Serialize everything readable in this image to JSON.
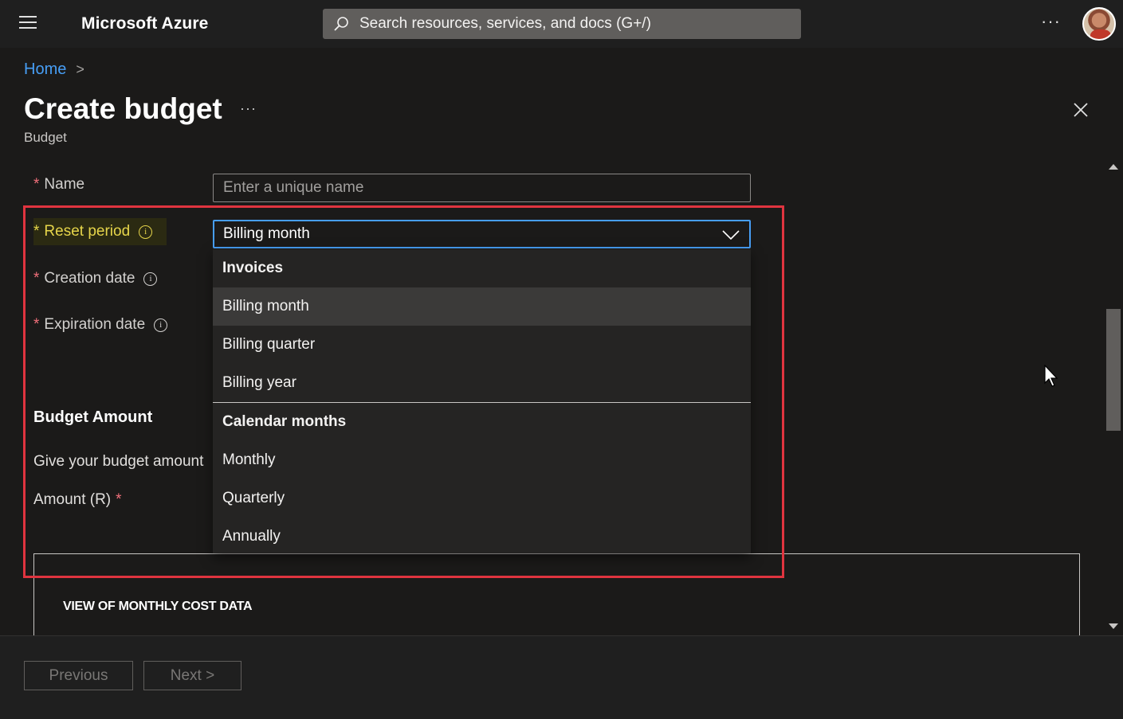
{
  "topbar": {
    "brand": "Microsoft Azure",
    "search_placeholder": "Search resources, services, and docs (G+/)",
    "more_label": "···"
  },
  "breadcrumb": {
    "home": "Home",
    "separator": ">"
  },
  "header": {
    "title": "Create budget",
    "more_label": "···",
    "subtitle": "Budget"
  },
  "form": {
    "name": {
      "label": "Name",
      "required_mark": "*",
      "placeholder": "Enter a unique name",
      "value": ""
    },
    "reset_period": {
      "label": "Reset period",
      "required_mark": "*",
      "info": "i",
      "selected": "Billing month",
      "options": {
        "group1_header": "Invoices",
        "group1_items": [
          "Billing month",
          "Billing quarter",
          "Billing year"
        ],
        "group2_header": "Calendar months",
        "group2_items": [
          "Monthly",
          "Quarterly",
          "Annually"
        ]
      }
    },
    "creation_date": {
      "label": "Creation date",
      "required_mark": "*",
      "info": "i"
    },
    "expiration_date": {
      "label": "Expiration date",
      "required_mark": "*",
      "info": "i"
    }
  },
  "budget_amount": {
    "section_title": "Budget Amount",
    "helper": "Give your budget amount",
    "amount_label": "Amount (R)",
    "required_mark": "*"
  },
  "chart_panel": {
    "title": "VIEW OF MONTHLY COST DATA"
  },
  "footer": {
    "previous": "Previous",
    "next": "Next >"
  },
  "colors": {
    "accent": "#479ef5",
    "highlight_box": "#e0343f",
    "required": "#f1707b",
    "highlight_label": "#e6d54a"
  }
}
